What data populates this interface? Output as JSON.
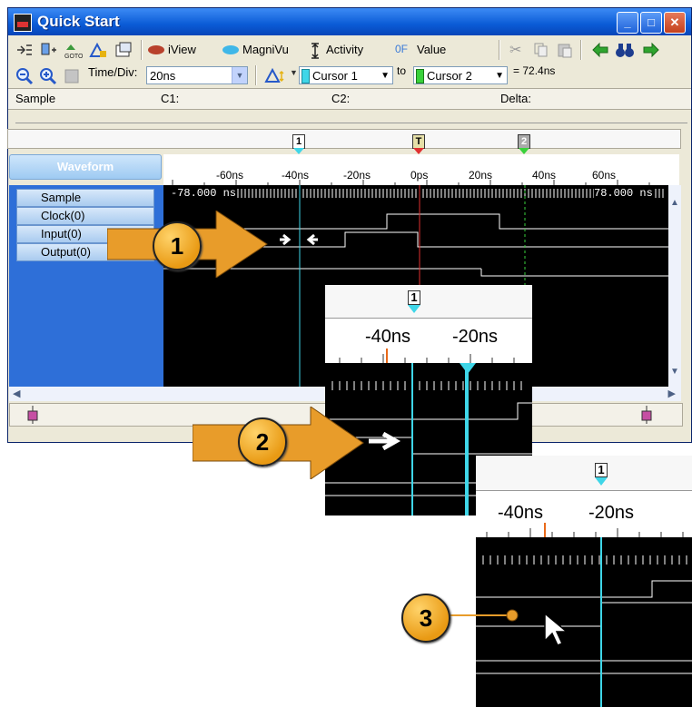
{
  "window": {
    "title": "Quick Start"
  },
  "toolbar1": {
    "iview_label": "iView",
    "magnivu_label": "MagniVu",
    "activity_label": "Activity",
    "value_prefix": "0F",
    "value_label": "Value"
  },
  "toolbar2": {
    "timediv_label": "Time/Div:",
    "timediv_value": "20ns",
    "cursor1_label": "Cursor 1",
    "to_label": "to",
    "cursor2_label": "Cursor 2",
    "delta_value": "= 72.4ns"
  },
  "infobar": {
    "sample_label": "Sample",
    "c1_label": "C1:",
    "c2_label": "C2:",
    "delta_label": "Delta:"
  },
  "cursor_markers": {
    "c1": "1",
    "trigger": "T",
    "c2": "2"
  },
  "waveform": {
    "header_label": "Waveform",
    "ruler_ticks": [
      "-60ns",
      "-40ns",
      "-20ns",
      "0ps",
      "20ns",
      "40ns",
      "60ns"
    ],
    "left_time": "-78.000 ns",
    "right_time": "78.000 ns",
    "signals": [
      "Sample",
      "Clock(0)",
      "Input(0)",
      "Output(0)"
    ]
  },
  "zoom1": {
    "cursor_label": "1",
    "ticks": [
      "-40ns",
      "-20ns"
    ]
  },
  "zoom2": {
    "cursor_label": "1",
    "ticks": [
      "-40ns",
      "-20ns"
    ]
  },
  "callouts": [
    "1",
    "2",
    "3"
  ],
  "colors": {
    "cursor1": "#3fd6e8",
    "trigger": "#e03030",
    "cursor2": "#39d13b",
    "arrow": "#e89c2a",
    "title_bar": "#0a5bd6"
  }
}
